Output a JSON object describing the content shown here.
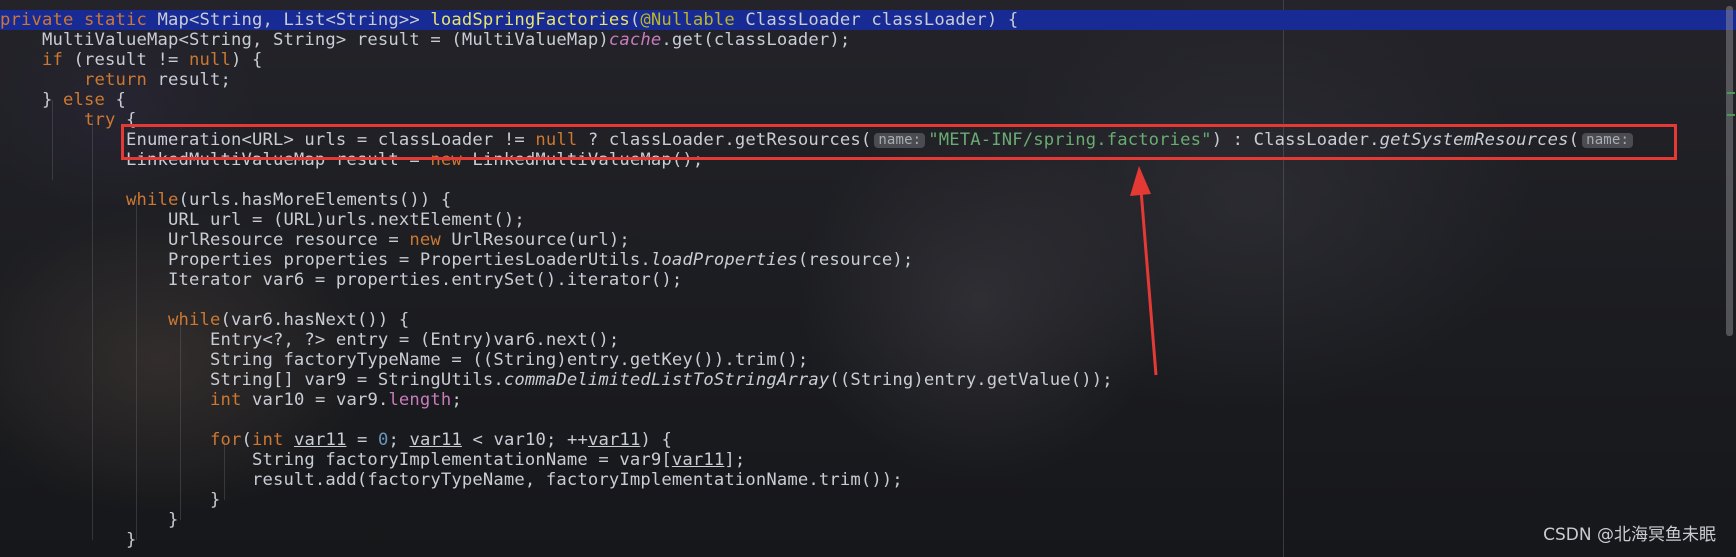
{
  "code": {
    "l1": {
      "a": "private static ",
      "b": "Map",
      "c": "<String, List<String>> ",
      "d": "loadSpringFactories",
      "e": "(",
      "f": "@Nullable",
      "g": " ClassLoader classLoader) {"
    },
    "l2": {
      "a": "    MultiValueMap<String, String> result = (MultiValueMap)",
      "b": "cache",
      "c": ".get(classLoader);"
    },
    "l3": {
      "a": "    ",
      "b": "if",
      "c": " (result != ",
      "d": "null",
      "e": ") {"
    },
    "l4": {
      "a": "        ",
      "b": "return",
      "c": " result;"
    },
    "l5": {
      "a": "    } ",
      "b": "else",
      "c": " {"
    },
    "l6": {
      "a": "        ",
      "b": "try",
      "c": " {"
    },
    "l7": {
      "a": "            Enumeration<URL> urls = classLoader != ",
      "b": "null",
      "c": " ? classLoader.getResources(",
      "hint1": "name:",
      "d": "\"META-INF/spring.factories\"",
      "e": ") : ClassLoader.",
      "f": "getSystemResources",
      "g": "(",
      "hint2": "name:"
    },
    "l8": {
      "a": "            LinkedMultiValueMap result = ",
      "b": "new",
      "c": " LinkedMultiValueMap();"
    },
    "l9": {
      "a": "            ",
      "b": "while",
      "c": "(urls.hasMoreElements()) {"
    },
    "l10": {
      "a": "                URL url = (URL)urls.nextElement();"
    },
    "l11": {
      "a": "                UrlResource resource = ",
      "b": "new",
      "c": " UrlResource(url);"
    },
    "l12": {
      "a": "                Properties properties = PropertiesLoaderUtils.",
      "b": "loadProperties",
      "c": "(resource);"
    },
    "l13": {
      "a": "                Iterator var6 = properties.entrySet().iterator();"
    },
    "l14": {
      "a": "                ",
      "b": "while",
      "c": "(var6.hasNext()) {"
    },
    "l15": {
      "a": "                    Entry<?, ?> entry = (Entry)var6.next();"
    },
    "l16": {
      "a": "                    String factoryTypeName = ((String)entry.getKey()).trim();"
    },
    "l17": {
      "a": "                    String[] var9 = StringUtils.",
      "b": "commaDelimitedListToStringArray",
      "c": "((String)entry.getValue());"
    },
    "l18": {
      "a": "                    ",
      "b": "int",
      "c": " var10 = var9.",
      "d": "length",
      "e": ";"
    },
    "l19": {
      "a": "                    ",
      "b": "for",
      "c": "(",
      "d": "int",
      "e": " ",
      "f": "var11",
      "g": " = ",
      "h": "0",
      "i": "; ",
      "j": "var11",
      "k": " < var10; ++",
      "l": "var11",
      "m": ") {"
    },
    "l20": {
      "a": "                        String factoryImplementationName = var9[",
      "b": "var11",
      "c": "];"
    },
    "l21": {
      "a": "                        result.add(factoryTypeName, factoryImplementationName.trim());"
    },
    "l22": {
      "a": "                    }"
    },
    "l23": {
      "a": "                }"
    },
    "l24": {
      "a": "            }"
    }
  },
  "watermark": "CSDN @北海冥鱼未眠",
  "colors": {
    "highlight": "#182a94",
    "annotation_box": "#e53935",
    "keyword": "#cc7832",
    "string": "#6aab73"
  }
}
